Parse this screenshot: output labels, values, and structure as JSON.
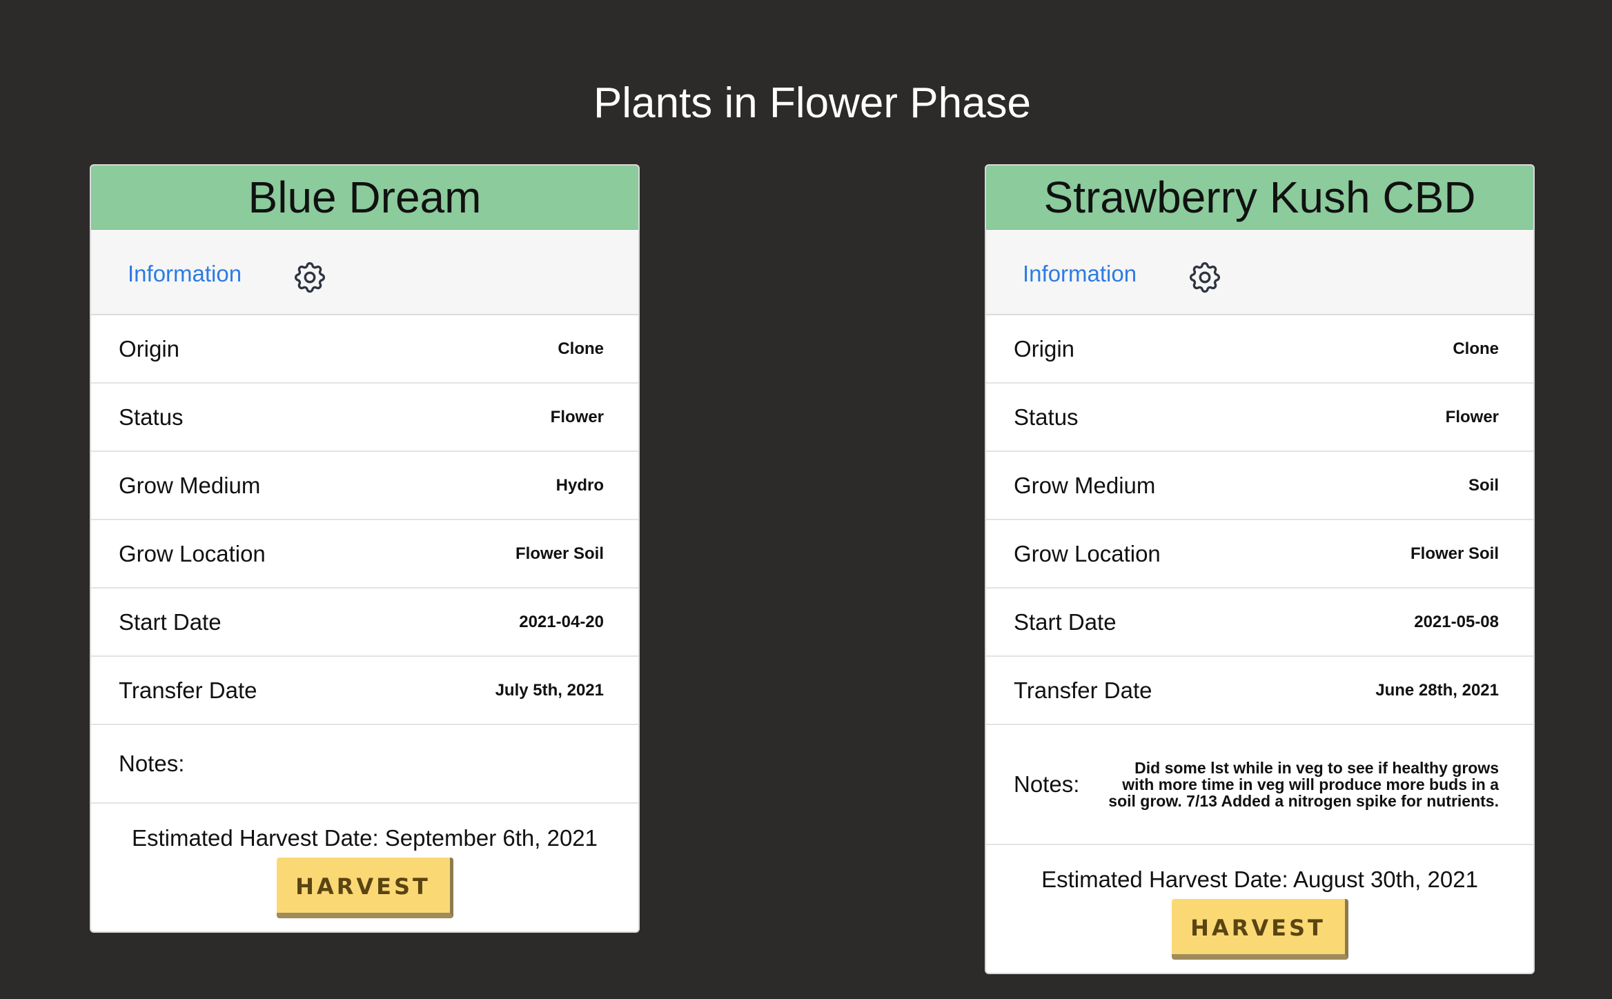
{
  "page": {
    "title": "Plants in Flower Phase"
  },
  "plants": [
    {
      "name": "Blue Dream",
      "tab_label": "Information",
      "fields": [
        {
          "label": "Origin",
          "value": "Clone"
        },
        {
          "label": "Status",
          "value": "Flower"
        },
        {
          "label": "Grow Medium",
          "value": "Hydro"
        },
        {
          "label": "Grow Location",
          "value": "Flower Soil"
        },
        {
          "label": "Start Date",
          "value": "2021-04-20"
        },
        {
          "label": "Transfer Date",
          "value": "July 5th, 2021"
        }
      ],
      "notes_label": "Notes:",
      "notes": "",
      "estimated_harvest": "Estimated Harvest Date: September 6th, 2021",
      "harvest_button": "HARVEST"
    },
    {
      "name": "Strawberry Kush CBD",
      "tab_label": "Information",
      "fields": [
        {
          "label": "Origin",
          "value": "Clone"
        },
        {
          "label": "Status",
          "value": "Flower"
        },
        {
          "label": "Grow Medium",
          "value": "Soil"
        },
        {
          "label": "Grow Location",
          "value": "Flower Soil"
        },
        {
          "label": "Start Date",
          "value": "2021-05-08"
        },
        {
          "label": "Transfer Date",
          "value": "June 28th, 2021"
        }
      ],
      "notes_label": "Notes:",
      "notes": "Did some lst while in veg to see if healthy grows with more time in veg will produce more buds in a soil grow. 7/13 Added a nitrogen spike for nutrients.",
      "estimated_harvest": "Estimated Harvest Date: August 30th, 2021",
      "harvest_button": "HARVEST"
    }
  ],
  "icons": {
    "settings": "gear-icon"
  },
  "colors": {
    "background": "#2c2b29",
    "card_header": "#8ccb9c",
    "link": "#2d7be3",
    "harvest_button": "#fad975"
  }
}
